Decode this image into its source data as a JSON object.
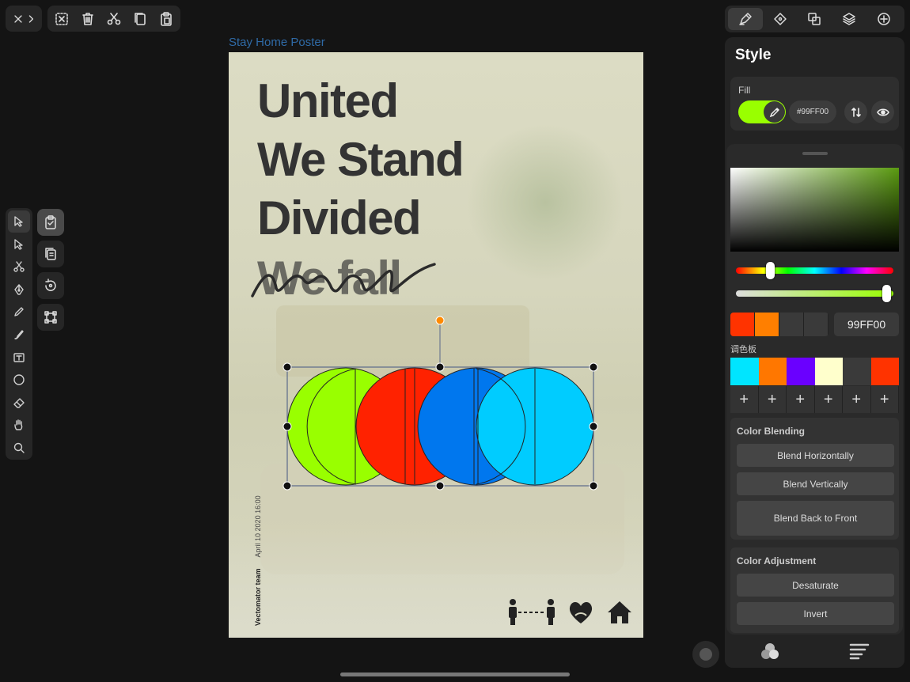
{
  "document": {
    "title": "Stay Home Poster"
  },
  "poster": {
    "headline_lines": [
      "United",
      "We Stand",
      "Divided",
      "We fall"
    ],
    "team": "Vectomator team",
    "date": "April 10 2020 16:00"
  },
  "style_panel": {
    "title": "Style",
    "fill": {
      "label": "Fill",
      "color": "#99FF00",
      "hex_display": "#99FF00"
    },
    "picker": {
      "hex_value": "99FF00",
      "recent_colors": [
        "#FF3300",
        "#FF7F00",
        "#3A3A3A",
        "#3A3A3A"
      ],
      "palette_label": "调色板",
      "palette": [
        "#00E5FF",
        "#FF7700",
        "#6A00FF",
        "#FFFFCC",
        "#3A3A3A",
        "#FF3300"
      ],
      "plus_symbol": "+"
    },
    "color_blending": {
      "title": "Color Blending",
      "buttons": [
        "Blend Horizontally",
        "Blend Vertically",
        "Blend Back to Front"
      ]
    },
    "color_adjustment": {
      "title": "Color Adjustment",
      "buttons": [
        "Desaturate",
        "Invert"
      ]
    }
  },
  "colors": {
    "green": "#99FF00",
    "red": "#FF2200",
    "blue": "#0077EE",
    "cyan": "#00CCFF"
  }
}
